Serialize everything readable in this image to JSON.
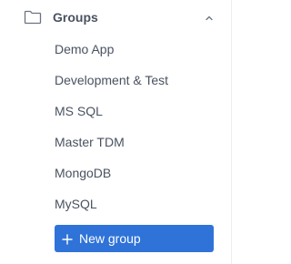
{
  "groups": {
    "header": {
      "label": "Groups",
      "icon": "folder-icon",
      "toggle_icon": "chevron-up-icon"
    },
    "items": [
      {
        "label": "Demo App"
      },
      {
        "label": "Development & Test"
      },
      {
        "label": "MS SQL"
      },
      {
        "label": "Master TDM"
      },
      {
        "label": "MongoDB"
      },
      {
        "label": "MySQL"
      }
    ],
    "new_group_button": {
      "label": "New group",
      "icon": "plus-icon"
    }
  },
  "colors": {
    "accent": "#2f73d9",
    "text": "#4a5260",
    "icon": "#6b7380",
    "divider": "#eceef1"
  }
}
